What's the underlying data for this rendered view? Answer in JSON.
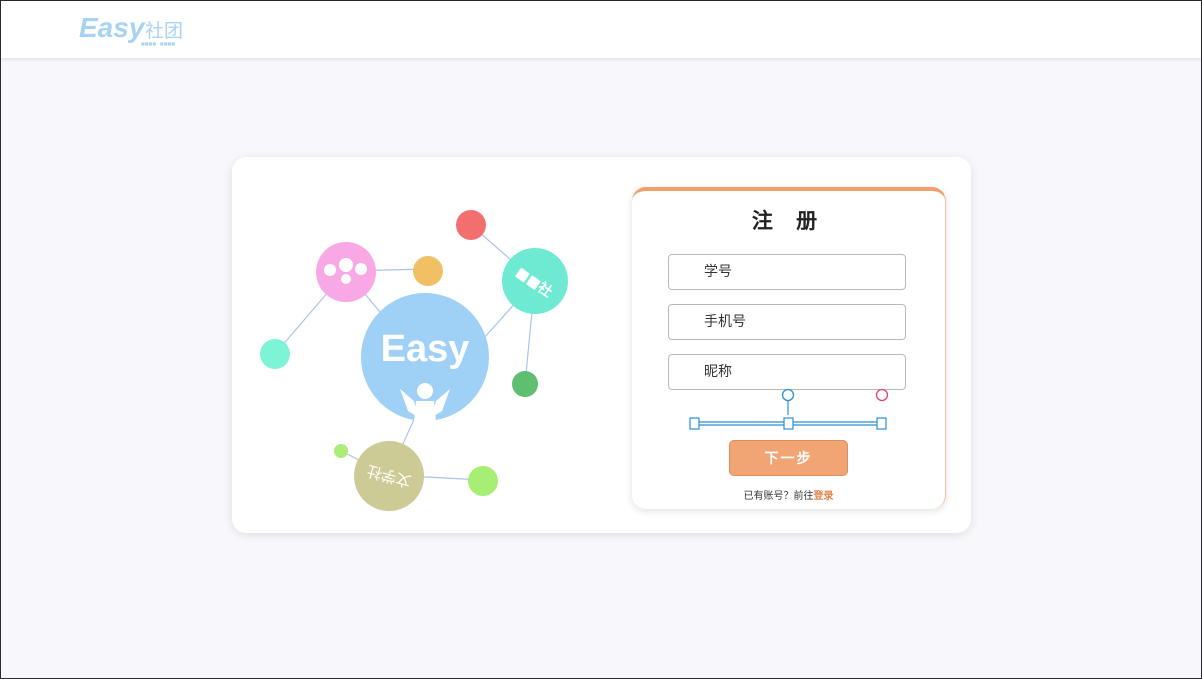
{
  "header": {
    "logo_word": "Easy",
    "logo_cn": "社团",
    "logo_tagline": "■■■■ · ■■■■"
  },
  "illustration": {
    "center_word": "Easy",
    "bubbles": {
      "top_right": "■■社",
      "bottom": "文学社"
    }
  },
  "form": {
    "title": "注 册",
    "student_id_placeholder": "学号",
    "phone_placeholder": "手机号",
    "nickname_placeholder": "昵称",
    "next_label": "下一步",
    "login_prompt": "已有账号？前往",
    "login_link": "登录"
  },
  "colors": {
    "accent": "#efa06c",
    "button": "#f1a474",
    "link": "#e0864c",
    "logo_blue": "#9fd0f5",
    "selection_blue": "#2a8fd6"
  }
}
